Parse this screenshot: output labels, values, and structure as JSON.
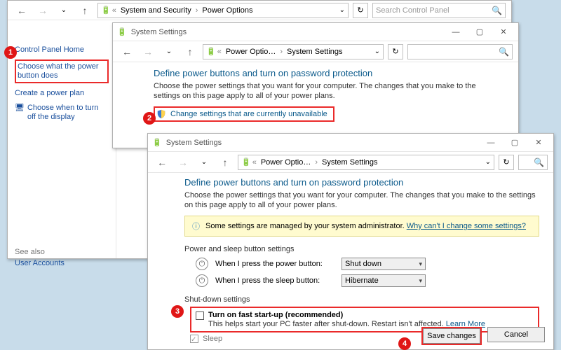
{
  "w1": {
    "crumb1": "System and Security",
    "crumb2": "Power Options",
    "search_placeholder": "Search Control Panel",
    "sidebar": {
      "header": "Control Panel Home",
      "links": [
        "Choose what the power button does",
        "Create a power plan",
        "Choose when to turn off the display"
      ],
      "see_also": "See also",
      "user_accounts": "User Accounts"
    }
  },
  "w2": {
    "title": "System Settings",
    "crumb1": "Power Optio…",
    "crumb2": "System Settings",
    "heading": "Define power buttons and turn on password protection",
    "subtext": "Choose the power settings that you want for your computer. The changes that you make to the settings on this page apply to all of your power plans.",
    "change_link": "Change settings that are currently unavailable"
  },
  "w3": {
    "title": "System Settings",
    "crumb1": "Power Optio…",
    "crumb2": "System Settings",
    "heading": "Define power buttons and turn on password protection",
    "subtext": "Choose the power settings that you want for your computer. The changes that you make to the settings on this page apply to all of your power plans.",
    "notice_text": "Some settings are managed by your system administrator.",
    "notice_link": "Why can't I change some settings?",
    "section_power": "Power and sleep button settings",
    "row_power_label": "When I press the power button:",
    "row_power_value": "Shut down",
    "row_sleep_label": "When I press the sleep button:",
    "row_sleep_value": "Hibernate",
    "section_shutdown": "Shut-down settings",
    "fast_startup_label": "Turn on fast start-up (recommended)",
    "fast_startup_hint": "This helps start your PC faster after shut-down. Restart isn't affected.",
    "learn_more": "Learn More",
    "sleep_label": "Sleep",
    "save": "Save changes",
    "cancel": "Cancel"
  },
  "badges": {
    "b1": "1",
    "b2": "2",
    "b3": "3",
    "b4": "4"
  }
}
